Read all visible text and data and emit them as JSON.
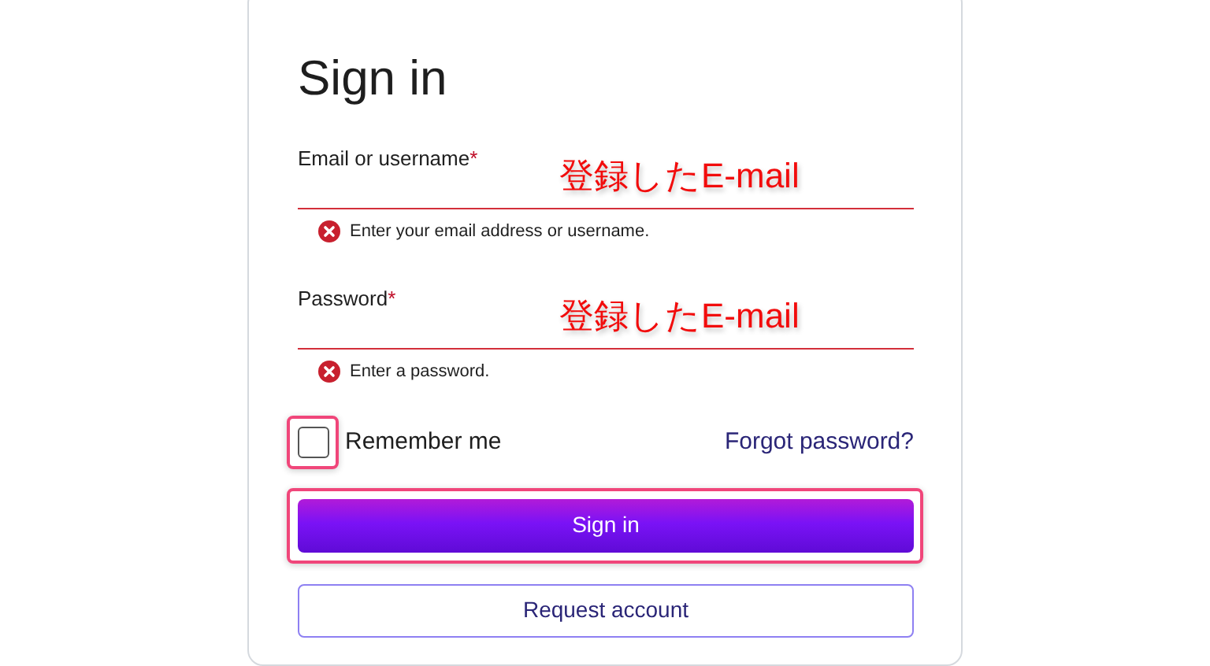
{
  "title": "Sign in",
  "fields": [
    {
      "label": "Email or username",
      "required_mark": "*",
      "invalid": true,
      "error": "Enter your email address or username.",
      "annotation": "登録したE-mail"
    },
    {
      "label": "Password",
      "required_mark": "*",
      "invalid": true,
      "error": "Enter a password.",
      "annotation": "登録したE-mail"
    }
  ],
  "remember": {
    "label": "Remember me",
    "checked": false,
    "highlighted": true
  },
  "forgot_link": "Forgot password?",
  "buttons": [
    {
      "label": "Sign in",
      "kind": "primary",
      "highlighted": true
    },
    {
      "label": "Request account",
      "kind": "outline",
      "highlighted": false
    }
  ]
}
